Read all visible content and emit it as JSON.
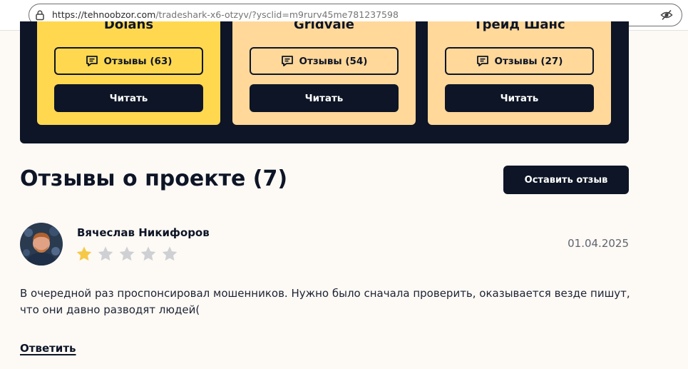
{
  "browser": {
    "url_host": "https://tehnoobzor.com",
    "url_path": "/tradeshark-x6-otzyv/?ysclid=m9rurv45me781237598"
  },
  "cards": [
    {
      "name": "Dolans",
      "reviews_label": "Отзывы (63)",
      "read_label": "Читать",
      "bg": "#ffd84f"
    },
    {
      "name": "Gridvale",
      "reviews_label": "Отзывы (54)",
      "read_label": "Читать",
      "bg": "#ffd89a"
    },
    {
      "name": "Трейд Шанс",
      "reviews_label": "Отзывы (27)",
      "read_label": "Читать",
      "bg": "#ffd89a"
    }
  ],
  "reviews_section": {
    "title": "Отзывы о проекте (7)",
    "leave_review_label": "Оставить отзыв"
  },
  "review": {
    "author": "Вячеслав Никифоров",
    "rating": 1,
    "rating_max": 5,
    "date": "01.04.2025",
    "text": "В очередной раз проспонсировал мошенников. Нужно было сначала проверить, оказывается везде пишут, что они давно разводят людей(",
    "reply_label": "Ответить"
  },
  "colors": {
    "dark": "#0d1526",
    "star_filled": "#f5c947",
    "star_empty": "#cfd0d3"
  }
}
